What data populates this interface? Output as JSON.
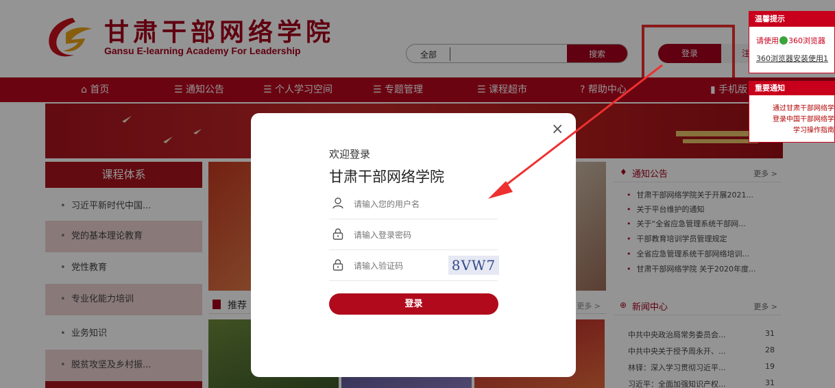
{
  "header": {
    "title": "甘肃干部网络学院",
    "subtitle": "Gansu E-learning Academy For Leadership",
    "search_scope": "全部",
    "search_button": "搜索",
    "login_button": "登录",
    "register_button": "注"
  },
  "nav": {
    "items": [
      {
        "icon": "home-icon",
        "label": "首页"
      },
      {
        "icon": "list-icon",
        "label": "通知公告"
      },
      {
        "icon": "list-icon",
        "label": "个人学习空间"
      },
      {
        "icon": "list-icon",
        "label": "专题管理"
      },
      {
        "icon": "list-icon",
        "label": "课程超市"
      },
      {
        "icon": "help-icon",
        "label": "帮助中心"
      },
      {
        "icon": "phone-icon",
        "label": "手机版"
      }
    ]
  },
  "tip_popup": {
    "title": "温馨提示",
    "line1_pre": "请使用",
    "line1_post": "360浏览器",
    "line2": "360浏览器安装使用1"
  },
  "notice_popup": {
    "title": "重要通知",
    "lines": [
      "通过甘肃干部网络学",
      "登录中国干部网络学",
      "学习操作指南"
    ]
  },
  "sidebar": {
    "title": "课程体系",
    "items": [
      "习近平新时代中国...",
      "党的基本理论教育",
      "党性教育",
      "专业化能力培训",
      "业务知识",
      "脱贫攻坚及乡村振..."
    ]
  },
  "recommend": {
    "title": "推荐",
    "more": "更多 >"
  },
  "notices": {
    "title": "通知公告",
    "more": "更多 >",
    "items": [
      "甘肃干部网络学院关于开展2021...",
      "关于平台维护的通知",
      "关于“全省应急管理系统干部网...",
      "干部教育培训学员管理规定",
      "全省应急管理系统干部网络培训...",
      "甘肃干部网络学院 关于2020年度..."
    ]
  },
  "news": {
    "title": "新闻中心",
    "more": "更多 >",
    "items": [
      {
        "text": "中共中央政治局常务委员会...",
        "count": "31"
      },
      {
        "text": "中共中央关于授予周永开、...",
        "count": "28"
      },
      {
        "text": "林铎：深入学习贯彻习近平...",
        "count": "19"
      },
      {
        "text": "习近平：全面加强知识产权...",
        "count": "31"
      }
    ]
  },
  "modal": {
    "welcome": "欢迎登录",
    "title": "甘肃干部网络学院",
    "close": "×",
    "username_placeholder": "请输入您的用户名",
    "password_placeholder": "请输入登录密码",
    "captcha_placeholder": "请输入验证码",
    "captcha_code": "8VW7",
    "login_button": "登录"
  },
  "colors": {
    "brand_red": "#a6001c",
    "nav_red": "#b8071e",
    "highlight": "#ee3030"
  }
}
